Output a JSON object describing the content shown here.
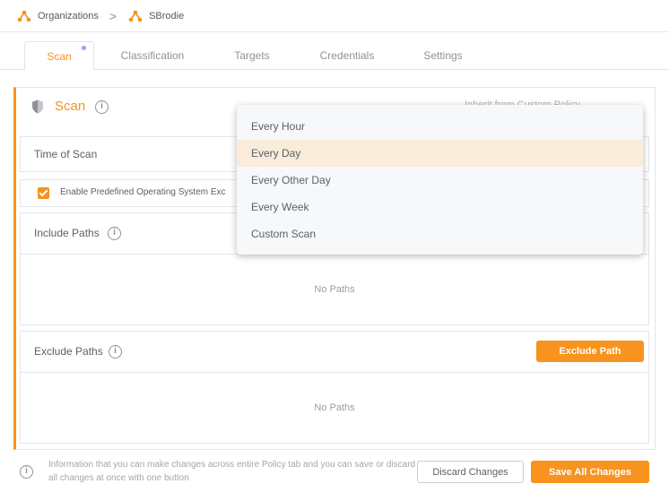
{
  "breadcrumb": {
    "items": [
      {
        "label": "Organizations",
        "icon": "organization-icon"
      },
      {
        "label": "SBrodie",
        "icon": "organization-icon"
      }
    ],
    "separator": ">"
  },
  "tabs": [
    {
      "label": "Scan",
      "active": true,
      "has_indicator": true
    },
    {
      "label": "Classification",
      "active": false
    },
    {
      "label": "Targets",
      "active": false
    },
    {
      "label": "Credentials",
      "active": false
    },
    {
      "label": "Settings",
      "active": false
    }
  ],
  "panel": {
    "title": "Scan",
    "inherit_label": "Inherit from Custom Policy"
  },
  "time_of_scan": {
    "label": "Time of Scan",
    "options": [
      "Every Hour",
      "Every Day",
      "Every Other Day",
      "Every Week",
      "Custom Scan"
    ],
    "selected": "Every Day"
  },
  "predefined": {
    "label": "Enable Predefined Operating System Exc",
    "checked": true
  },
  "include_paths": {
    "label": "Include Paths",
    "empty_text": "No Paths"
  },
  "exclude_paths": {
    "label": "Exclude Paths",
    "button_label": "Exclude Path",
    "empty_text": "No Paths"
  },
  "footer": {
    "info_text": "Information that you can make changes across entire Policy tab and you can save or discard all changes at once with one button",
    "discard_label": "Discard Changes",
    "save_label": "Save All Changes"
  },
  "colors": {
    "accent": "#f7931e",
    "selected_option_bg": "#f9ecdb"
  }
}
